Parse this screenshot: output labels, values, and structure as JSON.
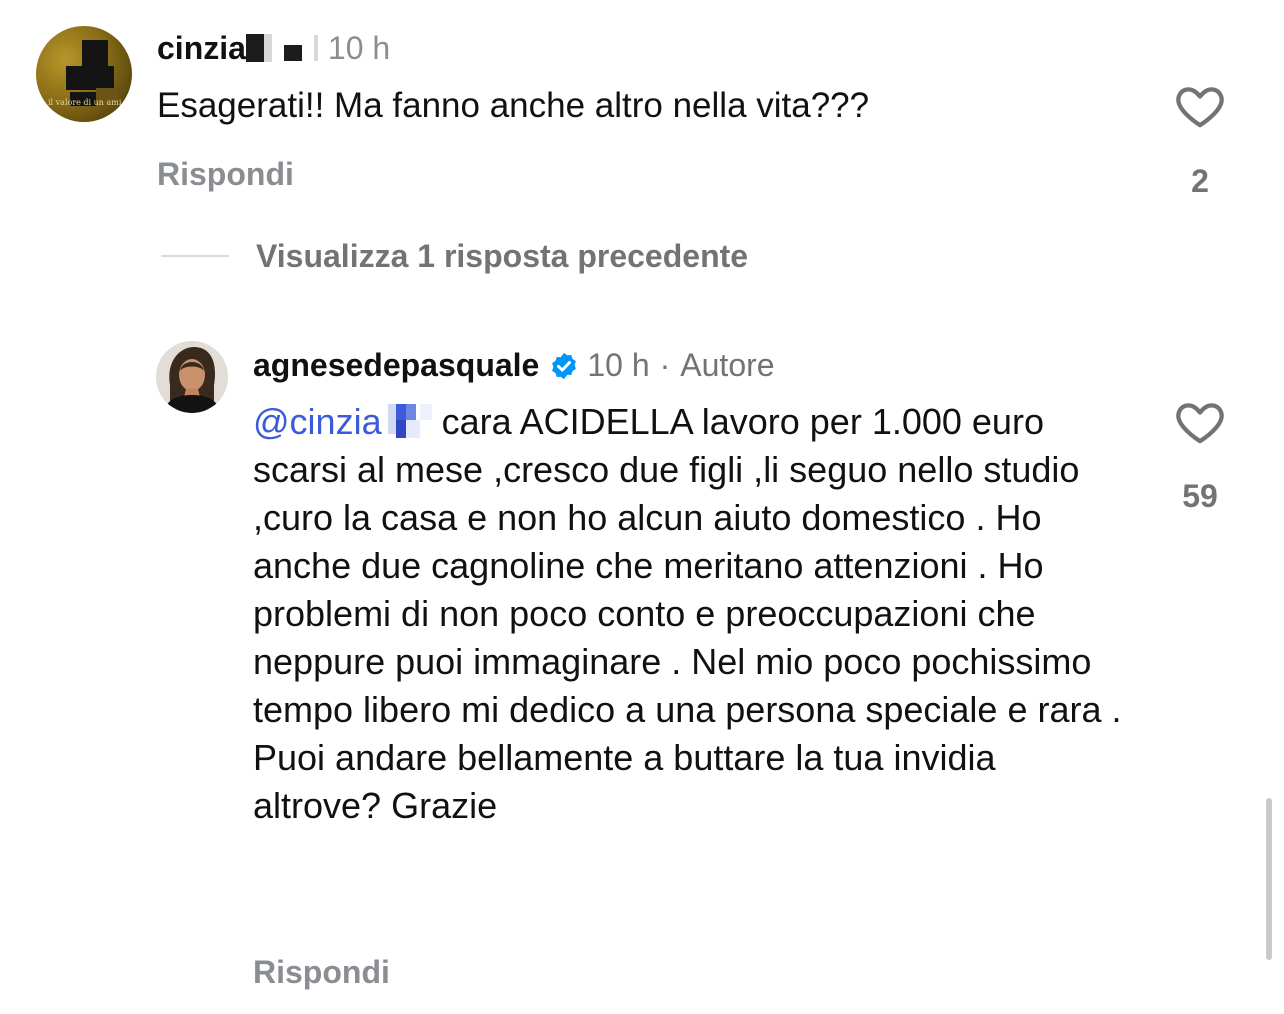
{
  "comment1": {
    "username": "cinzia",
    "time": "10 h",
    "text": "Esagerati!! Ma fanno anche altro nella vita???",
    "reply_label": "Rispondi",
    "like_count": "2",
    "avatar_caption": "il valore di un ami"
  },
  "replies_toggle": {
    "label": "Visualizza 1 risposta precedente"
  },
  "comment2": {
    "username": "agnesedepasquale",
    "time": "10 h",
    "separator": "·",
    "author_label": "Autore",
    "mention": "@cinzia",
    "text": "cara ACIDELLA lavoro per 1.000 euro scarsi al mese ,cresco due figli ,li seguo nello studio ,curo la casa e non ho alcun aiuto domestico . Ho anche due cagnoline che meritano attenzioni . Ho problemi di non poco conto e preoccupazioni che neppure puoi immaginare . Nel mio poco pochissimo tempo libero mi dedico a una persona speciale e rara . Puoi andare bellamente a buttare la tua invidia altrove? Grazie",
    "reply_label": "Rispondi",
    "like_count": "59"
  },
  "icons": {
    "like": "heart-outline-icon",
    "verified": "verified-badge-icon"
  },
  "colors": {
    "mention": "#3b5bdb",
    "verified": "#0095f6",
    "muted": "#737373"
  }
}
